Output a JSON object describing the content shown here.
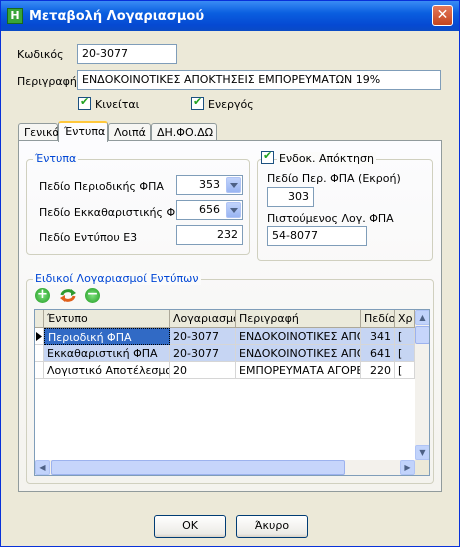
{
  "window": {
    "title": "Μεταβολή Λογαριασμού",
    "app_icon_letter": "H"
  },
  "form": {
    "code_label": "Κωδικός",
    "code_value": "20-3077",
    "desc_label": "Περιγραφή",
    "desc_value": "ΕΝΔΟΚΟΙΝΟΤΙΚΕΣ ΑΠΟΚΤΗΣΕΙΣ ΕΜΠΟΡΕΥΜΑΤΩΝ 19%",
    "moving_label": "Κινείται",
    "active_label": "Ενεργός"
  },
  "tabs": [
    "Γενικά",
    "Έντυπα",
    "Λοιπά",
    "ΔΗ.ΦΟ.ΔΩ"
  ],
  "forms_group": {
    "title": "Έντυπα",
    "periodic_label": "Πεδίο Περιοδικής ΦΠΑ",
    "periodic_value": "353",
    "clearing_label": "Πεδίο Εκκαθαριστικής ΦΠΑ",
    "clearing_value": "656",
    "e3_label": "Πεδίο Εντύπου Ε3",
    "e3_value": "232"
  },
  "intra_group": {
    "title": "Ενδοκ. Απόκτηση",
    "field_label": "Πεδίο Περ. ΦΠΑ (Εκροή)",
    "field_value": "303",
    "credit_label": "Πιστούμενος Λογ. ΦΠΑ",
    "credit_value": "54-8077"
  },
  "special_group": {
    "title": "Ειδικοί Λογαριασμοί Εντύπων"
  },
  "grid": {
    "columns": [
      "Έντυπο",
      "Λογαριασμός",
      "Περιγραφή",
      "Πεδίο",
      "Χρ"
    ],
    "rows": [
      [
        "Περιοδική ΦΠΑ",
        "20-3077",
        "ΕΝΔΟΚΟΙΝΟΤΙΚΕΣ ΑΠΟΚΤ",
        "341",
        "["
      ],
      [
        "Εκκαθαριστική ΦΠΑ",
        "20-3077",
        "ΕΝΔΟΚΟΙΝΟΤΙΚΕΣ ΑΠΟΚΤ",
        "641",
        "["
      ],
      [
        "Λογιστικό Αποτέλεσμα",
        "20",
        "ΕΜΠΟΡΕΥΜΑΤΑ ΑΓΟΡΕΣ",
        "220",
        "["
      ]
    ]
  },
  "buttons": {
    "ok": "OK",
    "cancel": "Άκυρο"
  }
}
